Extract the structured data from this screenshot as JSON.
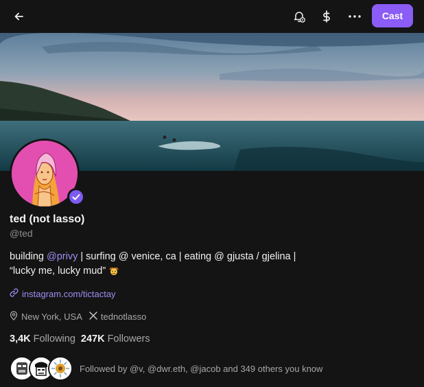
{
  "topbar": {
    "cast_label": "Cast"
  },
  "profile": {
    "display_name": "ted (not lasso)",
    "handle": "@ted",
    "bio_prefix": "building ",
    "bio_mention": "@privy",
    "bio_rest": " | surfing @ venice, ca | eating @ gjusta / gjelina |",
    "bio_line2": "“lucky me, lucky mud”",
    "link": "instagram.com/tictactay",
    "location": "New York, USA",
    "x_handle": "tednotlasso"
  },
  "stats": {
    "following_count": "3,4K",
    "following_label": "Following",
    "followers_count": "247K",
    "followers_label": "Followers"
  },
  "followed_by": "Followed by @v, @dwr.eth, @jacob and 349 others you know",
  "icons": [
    "back-arrow-icon",
    "bell-settings-icon",
    "dollar-icon",
    "more-icon",
    "verified-badge-icon",
    "link-icon",
    "location-pin-icon",
    "x-logo-icon",
    "cowboy-emoji-icon"
  ],
  "colors": {
    "accent": "#8b5cf6",
    "mention": "#a18cf4",
    "background": "#141414"
  }
}
